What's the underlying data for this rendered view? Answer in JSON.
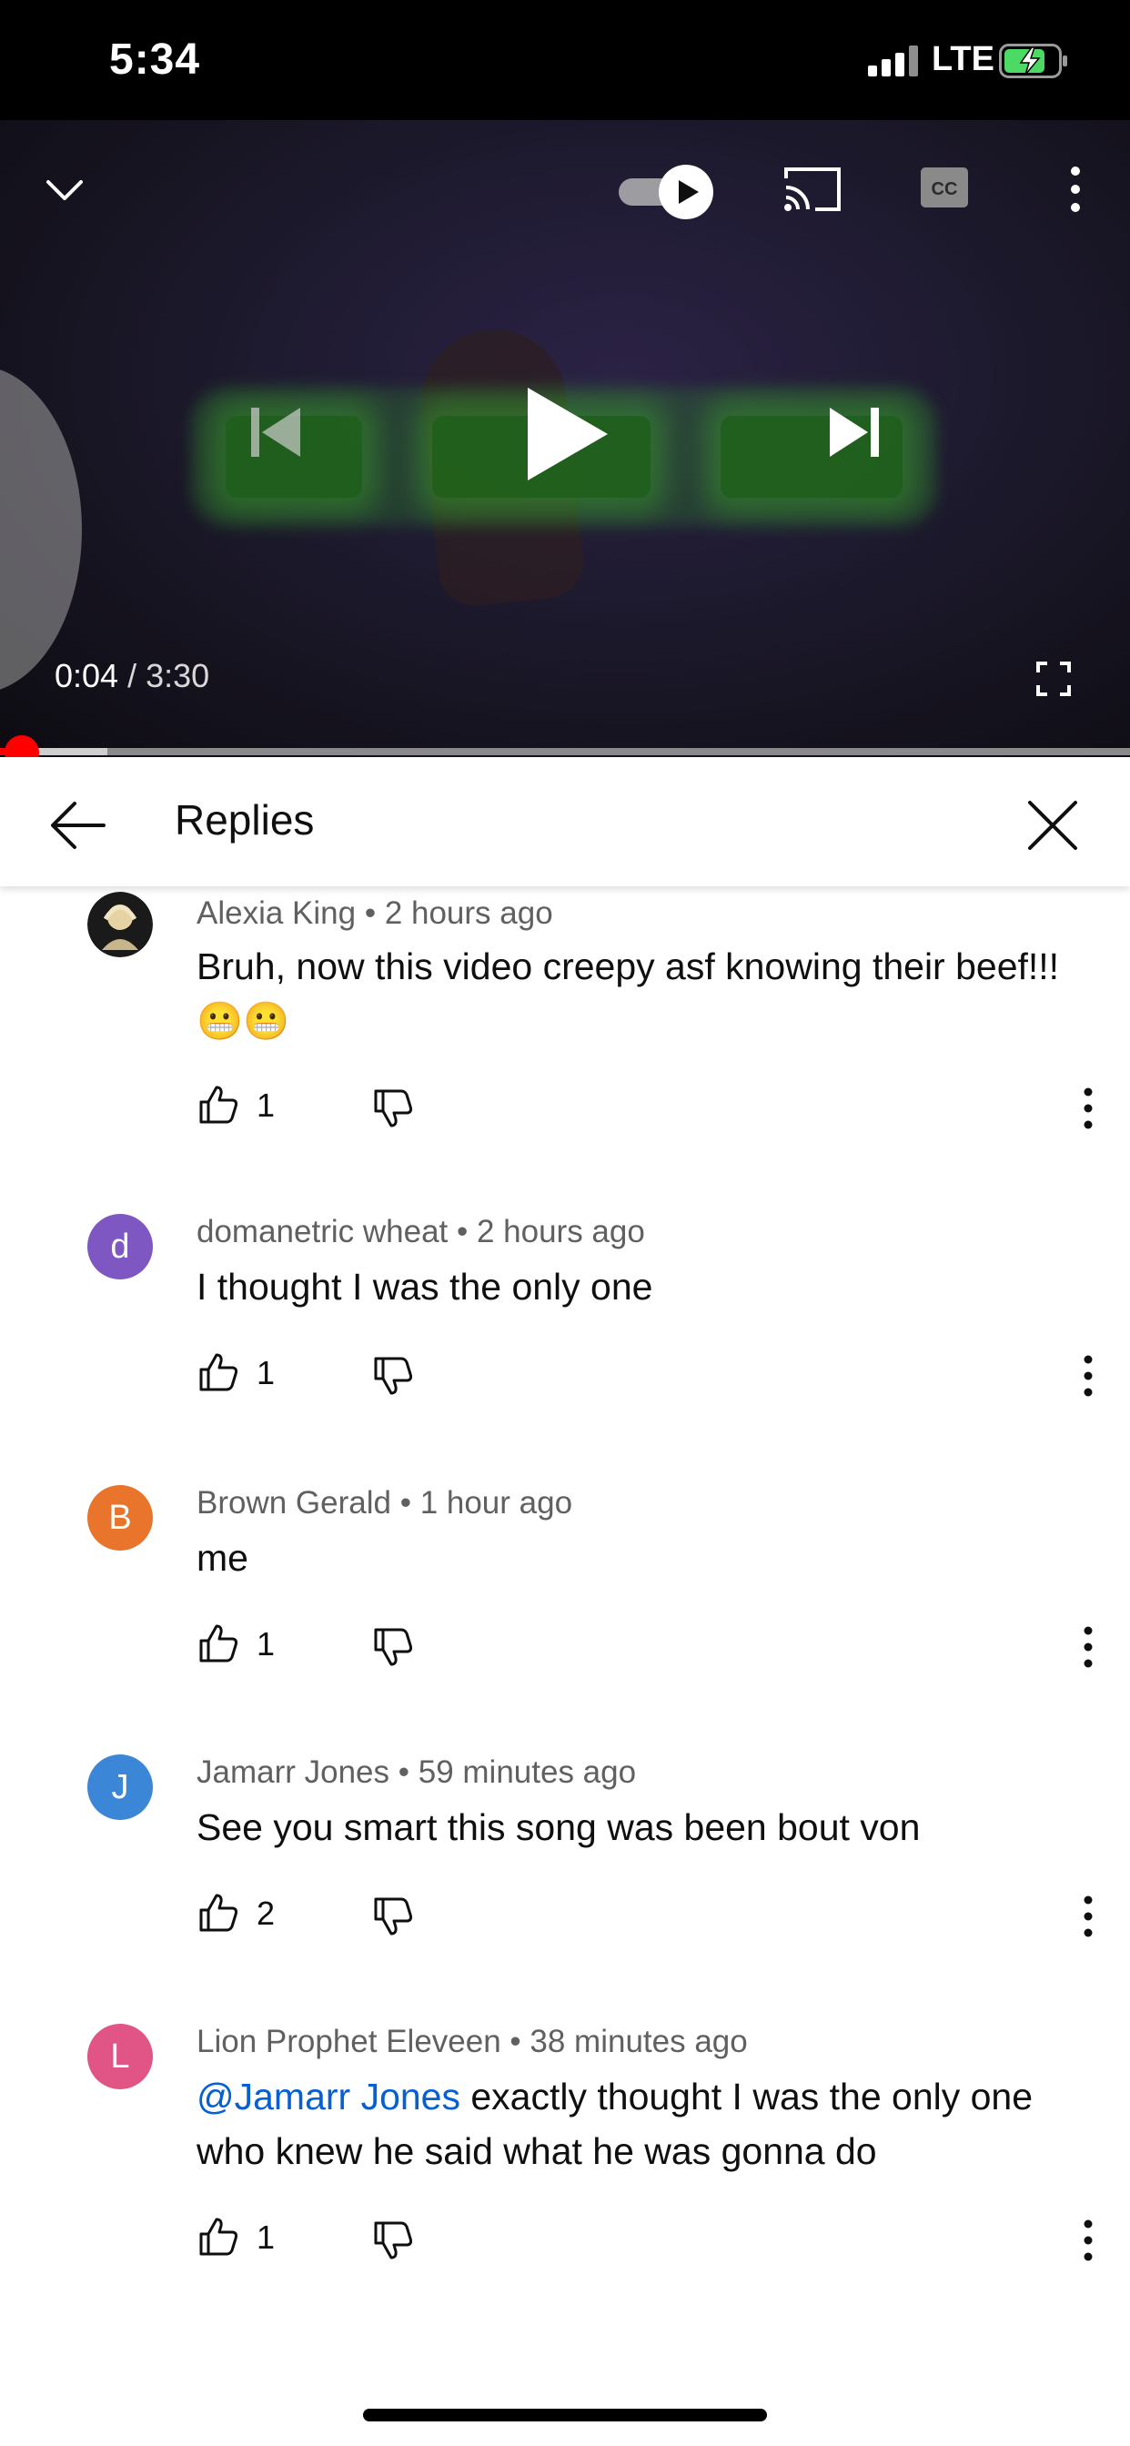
{
  "status_bar": {
    "time": "5:34",
    "network": "LTE",
    "icons": [
      "signal-bars-icon",
      "battery-charging-icon"
    ],
    "battery_color": "#4cd964"
  },
  "player": {
    "current_time": "0:04",
    "separator": " / ",
    "duration": "3:30",
    "autoplay": true,
    "progress_fraction": 0.019,
    "icons": [
      "chevron-down-icon",
      "autoplay-toggle-icon",
      "cast-icon",
      "captions-icon",
      "more-vertical-icon",
      "previous-icon",
      "play-icon",
      "next-icon",
      "fullscreen-icon"
    ]
  },
  "replies_panel": {
    "title": "Replies",
    "icons": [
      "back-arrow-icon",
      "close-icon"
    ]
  },
  "comments": [
    {
      "author": "Alexia King",
      "time": "2 hours ago",
      "avatar_letter": "",
      "avatar_color": "#1a1a1a",
      "text": "Bruh, now this video creepy asf knowing their beef!!!",
      "emoji": "😬😬",
      "likes": "1"
    },
    {
      "author": "domanetric wheat",
      "time": "2 hours ago",
      "avatar_letter": "d",
      "avatar_color": "#7e57c2",
      "text": "I thought I was the only one",
      "likes": "1"
    },
    {
      "author": "Brown Gerald",
      "time": "1 hour ago",
      "avatar_letter": "B",
      "avatar_color": "#e8752b",
      "text": "me",
      "likes": "1"
    },
    {
      "author": "Jamarr Jones",
      "time": "59 minutes ago",
      "avatar_letter": "J",
      "avatar_color": "#3b86d6",
      "text": "See you smart this song was been bout von",
      "likes": "2"
    },
    {
      "author": "Lion Prophet Eleveen",
      "time": "38 minutes ago",
      "avatar_letter": "L",
      "avatar_color": "#e05586",
      "mention": "@Jamarr Jones",
      "text": " exactly thought I was the only one who knew he said what he was gonna do",
      "likes": "1"
    }
  ],
  "meta_separator": " • ",
  "colors": {
    "accent_red": "#ff0000",
    "mention_blue": "#065fd4",
    "meta_gray": "#606060"
  }
}
